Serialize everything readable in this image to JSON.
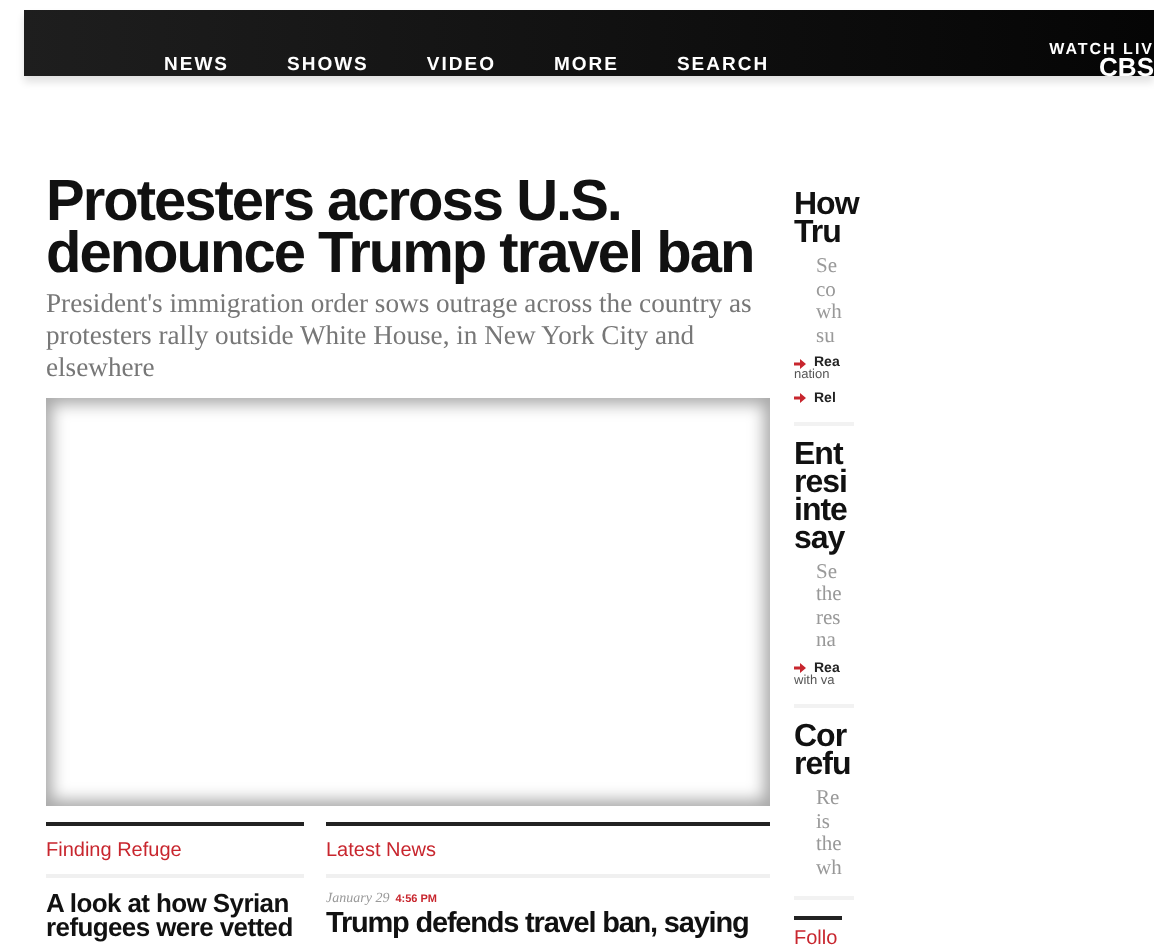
{
  "nav": {
    "items": [
      "NEWS",
      "SHOWS",
      "VIDEO",
      "MORE",
      "SEARCH"
    ],
    "watch": "WATCH LIV",
    "brand": "CBS"
  },
  "lead": {
    "headline": "Protesters across U.S. denounce Trump travel ban",
    "dek": "President's immigration order sows outrage across the country as protesters rally outside White House, in New York City and elsewhere"
  },
  "sidebar": {
    "stories": [
      {
        "headline_lines": [
          "How",
          "Tru"
        ],
        "summary_lines": [
          "Se",
          "co",
          "wh",
          "su"
        ],
        "links": [
          {
            "text": "Rea",
            "continuation": "nation"
          },
          {
            "text": "Rel"
          }
        ]
      },
      {
        "headline_lines": [
          "Ent",
          "resi",
          "inte",
          "say"
        ],
        "summary_lines": [
          "Se",
          "the",
          "res",
          "na"
        ],
        "links": [
          {
            "text": "Rea",
            "continuation": "with va"
          }
        ]
      },
      {
        "headline_lines": [
          "Cor",
          "refu"
        ],
        "summary_lines": [
          "Re",
          "is",
          "the",
          "wh"
        ]
      }
    ],
    "follow": "Follo"
  },
  "sections": [
    {
      "kind": "feature",
      "title": "Finding Refuge",
      "headline_lines": [
        "A look at how Syrian",
        "refugees were vetted"
      ]
    },
    {
      "kind": "latest",
      "title": "Latest News",
      "date": "January 29",
      "time": "4:56 PM",
      "headline_lines": [
        "Trump defends travel ban, saying"
      ]
    }
  ]
}
